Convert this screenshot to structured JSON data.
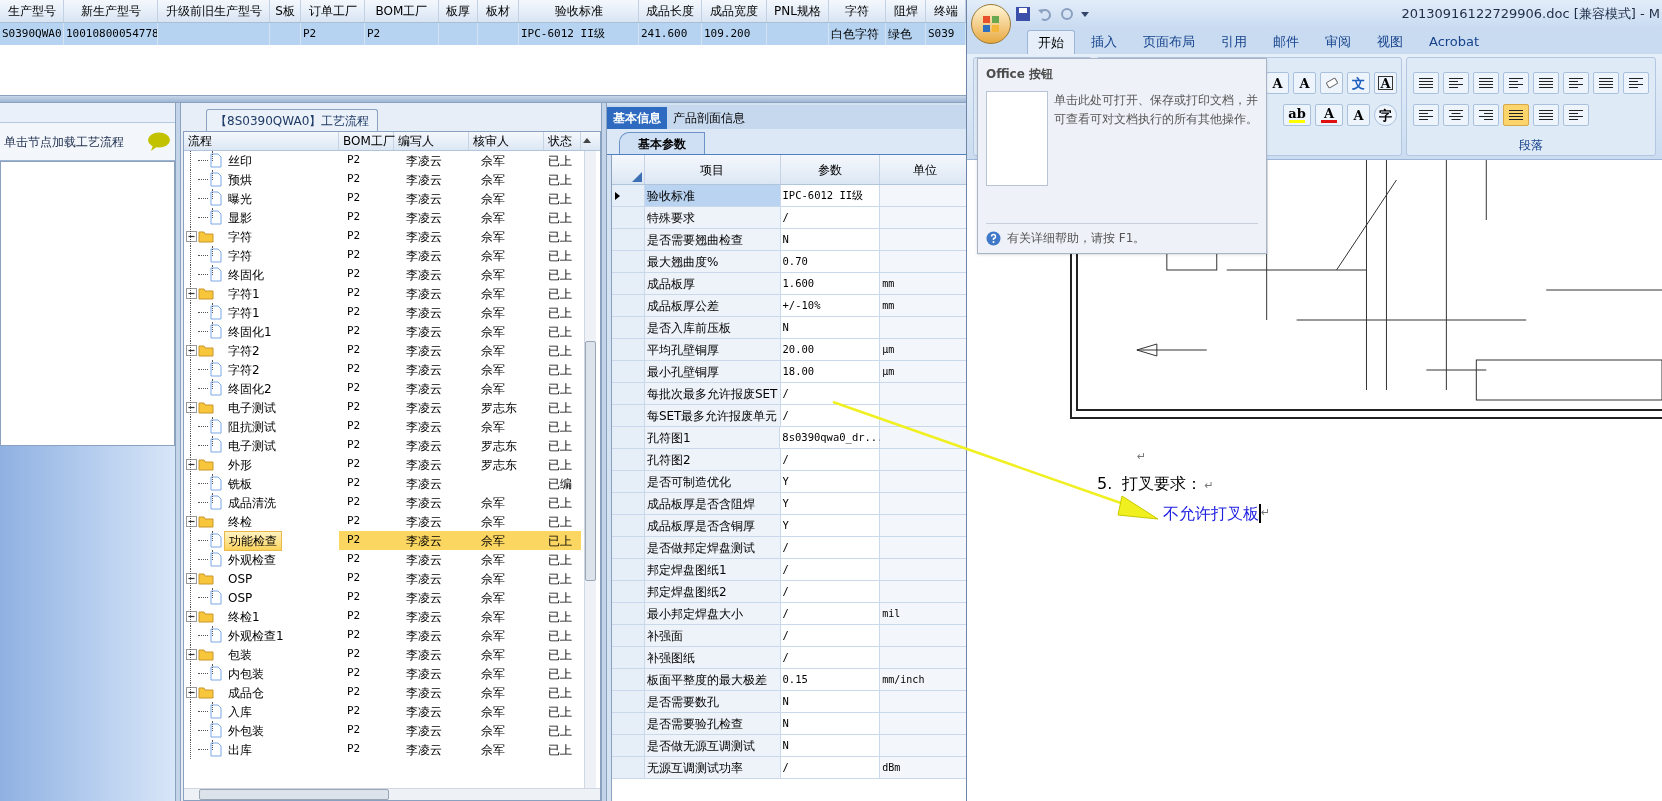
{
  "order_table": {
    "columns": [
      "生产型号",
      "新生产型号",
      "升级前旧生产型号",
      "S板",
      "订单工厂",
      "BOM工厂",
      "板厚",
      "板材",
      "验收标准",
      "成品长度",
      "成品宽度",
      "PNL规格",
      "字符",
      "阻焊",
      "终端"
    ],
    "rows": [
      {
        "selected": true,
        "cells": [
          "S0390QWA0",
          "10010800054778",
          "",
          "",
          "P2",
          "P2",
          "",
          "",
          "IPC-6012 II级",
          "241.600",
          "109.200",
          "",
          "白色字符",
          "绿色",
          "S039"
        ]
      }
    ]
  },
  "left_panel": {
    "hint": "单击节点加载工艺流程"
  },
  "process_tree": {
    "title": "【8S0390QWA0】工艺流程",
    "columns": [
      "流程",
      "BOM工厂",
      "编写人",
      "核审人",
      "状态"
    ],
    "continued_items": [
      {
        "name": "丝印",
        "bom": "P2",
        "author": "李凌云",
        "reviewer": "佘军",
        "status": "已上",
        "selected": false
      },
      {
        "name": "预烘",
        "bom": "P2",
        "author": "李凌云",
        "reviewer": "佘军",
        "status": "已上",
        "selected": false
      },
      {
        "name": "曝光",
        "bom": "P2",
        "author": "李凌云",
        "reviewer": "佘军",
        "status": "已上",
        "selected": false
      },
      {
        "name": "显影",
        "bom": "P2",
        "author": "李凌云",
        "reviewer": "佘军",
        "status": "已上",
        "selected": false
      }
    ],
    "groups": [
      {
        "name": "字符",
        "bom": "P2",
        "author": "李凌云",
        "reviewer": "佘军",
        "status": "已上",
        "selected": false,
        "expanded": true,
        "children": [
          {
            "name": "字符",
            "bom": "P2",
            "author": "李凌云",
            "reviewer": "佘军",
            "status": "已上",
            "selected": false
          },
          {
            "name": "终固化",
            "bom": "P2",
            "author": "李凌云",
            "reviewer": "佘军",
            "status": "已上",
            "selected": false
          }
        ]
      },
      {
        "name": "字符1",
        "bom": "P2",
        "author": "李凌云",
        "reviewer": "佘军",
        "status": "已上",
        "selected": false,
        "expanded": true,
        "children": [
          {
            "name": "字符1",
            "bom": "P2",
            "author": "李凌云",
            "reviewer": "佘军",
            "status": "已上",
            "selected": false
          },
          {
            "name": "终固化1",
            "bom": "P2",
            "author": "李凌云",
            "reviewer": "佘军",
            "status": "已上",
            "selected": false
          }
        ]
      },
      {
        "name": "字符2",
        "bom": "P2",
        "author": "李凌云",
        "reviewer": "佘军",
        "status": "已上",
        "selected": false,
        "expanded": true,
        "children": [
          {
            "name": "字符2",
            "bom": "P2",
            "author": "李凌云",
            "reviewer": "佘军",
            "status": "已上",
            "selected": false
          },
          {
            "name": "终固化2",
            "bom": "P2",
            "author": "李凌云",
            "reviewer": "佘军",
            "status": "已上",
            "selected": false
          }
        ]
      },
      {
        "name": "电子测试",
        "bom": "P2",
        "author": "李凌云",
        "reviewer": "罗志东",
        "status": "已上",
        "selected": false,
        "expanded": true,
        "children": [
          {
            "name": "阻抗测试",
            "bom": "P2",
            "author": "李凌云",
            "reviewer": "佘军",
            "status": "已上",
            "selected": false
          },
          {
            "name": "电子测试",
            "bom": "P2",
            "author": "李凌云",
            "reviewer": "罗志东",
            "status": "已上",
            "selected": false
          }
        ]
      },
      {
        "name": "外形",
        "bom": "P2",
        "author": "李凌云",
        "reviewer": "罗志东",
        "status": "已上",
        "selected": false,
        "expanded": true,
        "children": [
          {
            "name": "铣板",
            "bom": "P2",
            "author": "李凌云",
            "status": "已编",
            "selected": false
          },
          {
            "name": "成品清洗",
            "bom": "P2",
            "author": "李凌云",
            "reviewer": "佘军",
            "status": "已上",
            "selected": false
          }
        ]
      },
      {
        "name": "终检",
        "bom": "P2",
        "author": "李凌云",
        "reviewer": "佘军",
        "status": "已上",
        "selected": false,
        "expanded": true,
        "children": [
          {
            "name": "功能检查",
            "bom": "P2",
            "author": "李凌云",
            "reviewer": "佘军",
            "status": "已上",
            "selected": true
          },
          {
            "name": "外观检查",
            "bom": "P2",
            "author": "李凌云",
            "reviewer": "佘军",
            "status": "已上",
            "selected": false
          }
        ]
      },
      {
        "name": "OSP",
        "bom": "P2",
        "author": "李凌云",
        "reviewer": "佘军",
        "status": "已上",
        "selected": false,
        "expanded": true,
        "children": [
          {
            "name": "OSP",
            "bom": "P2",
            "author": "李凌云",
            "reviewer": "佘军",
            "status": "已上",
            "selected": false
          }
        ]
      },
      {
        "name": "终检1",
        "bom": "P2",
        "author": "李凌云",
        "reviewer": "佘军",
        "status": "已上",
        "selected": false,
        "expanded": true,
        "children": [
          {
            "name": "外观检查1",
            "bom": "P2",
            "author": "李凌云",
            "reviewer": "佘军",
            "status": "已上",
            "selected": false
          }
        ]
      },
      {
        "name": "包装",
        "bom": "P2",
        "author": "李凌云",
        "reviewer": "佘军",
        "status": "已上",
        "selected": false,
        "expanded": true,
        "children": [
          {
            "name": "内包装",
            "bom": "P2",
            "author": "李凌云",
            "reviewer": "佘军",
            "status": "已上",
            "selected": false
          }
        ]
      },
      {
        "name": "成品仓",
        "bom": "P2",
        "author": "李凌云",
        "reviewer": "佘军",
        "status": "已上",
        "selected": false,
        "expanded": true,
        "children": [
          {
            "name": "入库",
            "bom": "P2",
            "author": "李凌云",
            "reviewer": "佘军",
            "status": "已上",
            "selected": false
          },
          {
            "name": "外包装",
            "bom": "P2",
            "author": "李凌云",
            "reviewer": "佘军",
            "status": "已上",
            "selected": false
          },
          {
            "name": "出库",
            "bom": "P2",
            "author": "李凌云",
            "reviewer": "佘军",
            "status": "已上",
            "selected": false
          }
        ]
      }
    ]
  },
  "info_panel": {
    "tabs": [
      {
        "label": "基本信息",
        "selected": true
      },
      {
        "label": "产品剖面信息",
        "selected": false
      }
    ],
    "subtabs": [
      {
        "label": "基本参数",
        "selected": true
      }
    ],
    "columns": [
      "项目",
      "参数",
      "单位"
    ],
    "rows": [
      {
        "item": "验收标准",
        "value": "IPC-6012 II级",
        "unit": "",
        "selected": true
      },
      {
        "item": "特殊要求",
        "value": "/",
        "unit": "",
        "selected": false
      },
      {
        "item": "是否需要翘曲检查",
        "value": "N",
        "unit": "",
        "selected": false
      },
      {
        "item": "最大翘曲度%",
        "value": "0.70",
        "unit": "",
        "selected": false
      },
      {
        "item": "成品板厚",
        "value": "1.600",
        "unit": "mm",
        "selected": false
      },
      {
        "item": "成品板厚公差",
        "value": "+/-10%",
        "unit": "mm",
        "selected": false
      },
      {
        "item": "是否入库前压板",
        "value": "N",
        "unit": "",
        "selected": false
      },
      {
        "item": "平均孔壁铜厚",
        "value": "20.00",
        "unit": "μm",
        "selected": false
      },
      {
        "item": "最小孔壁铜厚",
        "value": "18.00",
        "unit": "μm",
        "selected": false
      },
      {
        "item": "每批次最多允许报废SET",
        "value": "/",
        "unit": "",
        "selected": false
      },
      {
        "item": "每SET最多允许报废单元",
        "value": "/",
        "unit": "",
        "selected": false
      },
      {
        "item": "孔符图1",
        "value": "8s0390qwa0_dr...",
        "unit": "",
        "selected": false
      },
      {
        "item": "孔符图2",
        "value": "/",
        "unit": "",
        "selected": false
      },
      {
        "item": "是否可制造优化",
        "value": "Y",
        "unit": "",
        "selected": false
      },
      {
        "item": "成品板厚是否含阻焊",
        "value": "Y",
        "unit": "",
        "selected": false
      },
      {
        "item": "成品板厚是否含铜厚",
        "value": "Y",
        "unit": "",
        "selected": false
      },
      {
        "item": "是否做邦定焊盘测试",
        "value": "/",
        "unit": "",
        "selected": false
      },
      {
        "item": "邦定焊盘图纸1",
        "value": "/",
        "unit": "",
        "selected": false
      },
      {
        "item": "邦定焊盘图纸2",
        "value": "/",
        "unit": "",
        "selected": false
      },
      {
        "item": "最小邦定焊盘大小",
        "value": "/",
        "unit": "mil",
        "selected": false
      },
      {
        "item": "补强面",
        "value": "/",
        "unit": "",
        "selected": false
      },
      {
        "item": "补强图纸",
        "value": "/",
        "unit": "",
        "selected": false
      },
      {
        "item": "板面平整度的最大极差",
        "value": "0.15",
        "unit": "mm/inch",
        "selected": false
      },
      {
        "item": "是否需要数孔",
        "value": "N",
        "unit": "",
        "selected": false
      },
      {
        "item": "是否需要验孔检查",
        "value": "N",
        "unit": "",
        "selected": false
      },
      {
        "item": "是否做无源互调测试",
        "value": "N",
        "unit": "",
        "selected": false
      },
      {
        "item": "无源互调测试功率",
        "value": "/",
        "unit": "dBm",
        "selected": false
      }
    ]
  },
  "word": {
    "title": "20130916122729906.doc [兼容模式] - M",
    "tabs": [
      {
        "label": "开始",
        "selected": true
      },
      {
        "label": "插入",
        "selected": false
      },
      {
        "label": "页面布局",
        "selected": false
      },
      {
        "label": "引用",
        "selected": false
      },
      {
        "label": "邮件",
        "selected": false
      },
      {
        "label": "审阅",
        "selected": false
      },
      {
        "label": "视图",
        "selected": false
      },
      {
        "label": "Acrobat",
        "selected": false
      }
    ],
    "font_buttons_top": [
      {
        "kind": "grow",
        "label": "A"
      },
      {
        "kind": "shrink",
        "label": "A"
      },
      {
        "kind": "clear"
      },
      {
        "kind": "phonetic",
        "label": "文"
      },
      {
        "kind": "boxed",
        "label": "A"
      }
    ],
    "font_buttons_bottom": [
      {
        "kind": "highlight",
        "label": "ab"
      },
      {
        "kind": "color",
        "label": "A"
      },
      {
        "kind": "shaded",
        "label": "A"
      },
      {
        "kind": "circled",
        "label": "字"
      }
    ],
    "alignment_buttons": [
      {
        "selected": false
      },
      {
        "selected": false
      },
      {
        "selected": false
      },
      {
        "selected": true
      },
      {
        "selected": false
      }
    ],
    "paragraph_group": "段落",
    "tooltip": {
      "title": "Office 按钮",
      "text": "单击此处可打开、保存或打印文档，并可查看可对文档执行的所有其他操作。",
      "help": "有关详细帮助，请按 F1。"
    },
    "document": {
      "empty_mark": "↵",
      "heading": "5.  打叉要求：",
      "heading_mark": "↵",
      "body": "不允许打叉板",
      "body_mark": "↵"
    }
  }
}
